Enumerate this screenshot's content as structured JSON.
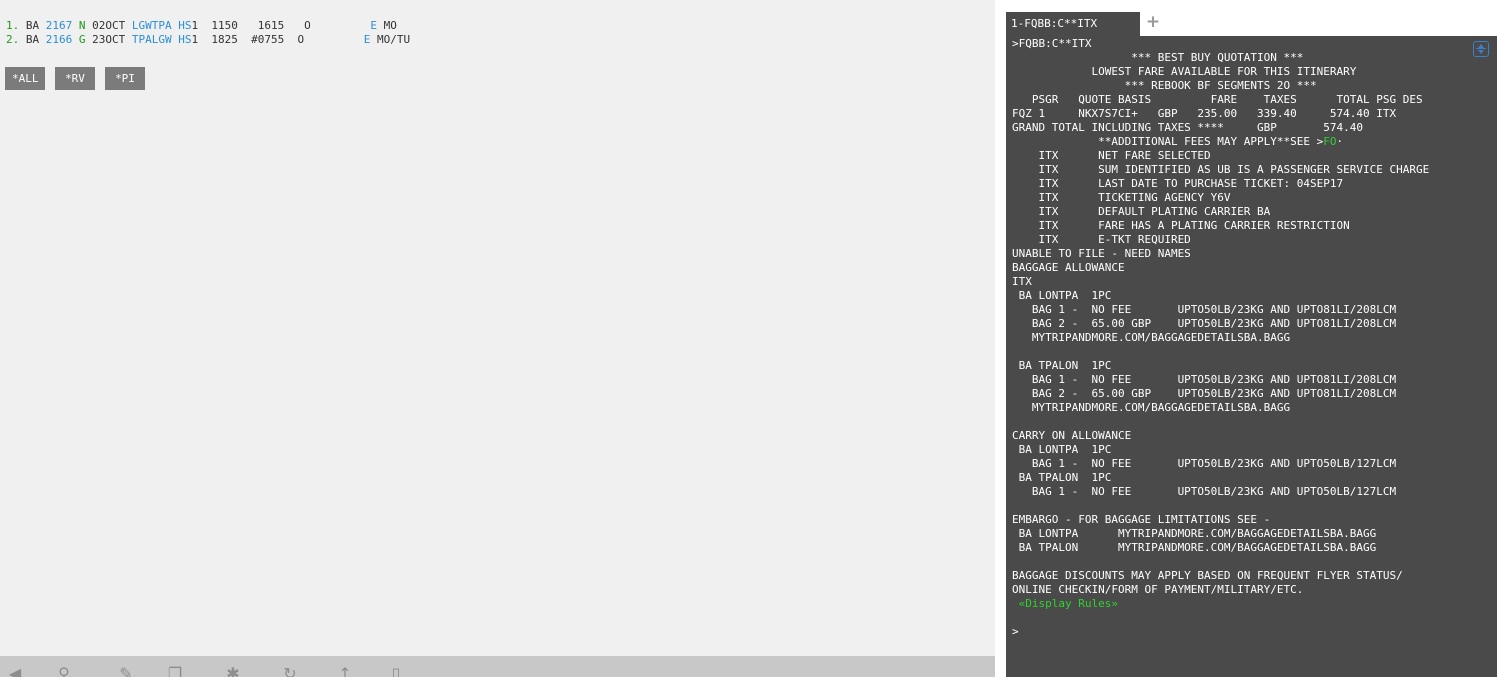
{
  "segments": [
    {
      "num": "1.",
      "carrier": "BA",
      "flight": "2167",
      "class": "N",
      "date": "02OCT",
      "route": "LGWTPA",
      "status": "HS",
      "qty": "1",
      "dep": "1150",
      "arr": "1615",
      "flag": "O",
      "eticket": "E",
      "days": "MO"
    },
    {
      "num": "2.",
      "carrier": "BA",
      "flight": "2166",
      "class": "G",
      "date": "23OCT",
      "route": "TPALGW",
      "status": "HS",
      "qty": "1",
      "dep": "1825",
      "arr": "#0755",
      "flag": "O",
      "eticket": "E",
      "days": "MO/TU"
    }
  ],
  "command_buttons": [
    "*ALL",
    "*RV",
    "*PI"
  ],
  "toolbar_icons": [
    "back-icon",
    "search-icon",
    "edit-icon",
    "copy-icon",
    "settings-icon",
    "refresh-icon",
    "arrow-icon",
    "document-icon"
  ],
  "tabs": [
    {
      "label": "1-FQBB:C**ITX"
    }
  ],
  "tab_add_label": "+",
  "terminal": {
    "lines": [
      ">FQBB:C**ITX",
      "                  *** BEST BUY QUOTATION ***",
      "            LOWEST FARE AVAILABLE FOR THIS ITINERARY",
      "                 *** REBOOK BF SEGMENTS 2O ***",
      "   PSGR   QUOTE BASIS         FARE    TAXES      TOTAL PSG DES",
      "FQZ 1     NKX7S7CI+   GBP   235.00   339.40     574.40 ITX",
      "GRAND TOTAL INCLUDING TAXES ****     GBP       574.40",
      "             **ADDITIONAL FEES MAY APPLY**SEE >",
      "    ITX      NET FARE SELECTED",
      "    ITX      SUM IDENTIFIED AS UB IS A PASSENGER SERVICE CHARGE",
      "    ITX      LAST DATE TO PURCHASE TICKET: 04SEP17",
      "    ITX      TICKETING AGENCY Y6V",
      "    ITX      DEFAULT PLATING CARRIER BA",
      "    ITX      FARE HAS A PLATING CARRIER RESTRICTION",
      "    ITX      E-TKT REQUIRED",
      "UNABLE TO FILE - NEED NAMES",
      "BAGGAGE ALLOWANCE",
      "ITX",
      " BA LONTPA  1PC",
      "   BAG 1 -  NO FEE       UPTO50LB/23KG AND UPTO81LI/208LCM",
      "   BAG 2 -  65.00 GBP    UPTO50LB/23KG AND UPTO81LI/208LCM",
      "   MYTRIPANDMORE.COM/BAGGAGEDETAILSBA.BAGG",
      "",
      " BA TPALON  1PC",
      "   BAG 1 -  NO FEE       UPTO50LB/23KG AND UPTO81LI/208LCM",
      "   BAG 2 -  65.00 GBP    UPTO50LB/23KG AND UPTO81LI/208LCM",
      "   MYTRIPANDMORE.COM/BAGGAGEDETAILSBA.BAGG",
      "",
      "CARRY ON ALLOWANCE",
      " BA LONTPA  1PC",
      "   BAG 1 -  NO FEE       UPTO50LB/23KG AND UPTO50LB/127LCM",
      " BA TPALON  1PC",
      "   BAG 1 -  NO FEE       UPTO50LB/23KG AND UPTO50LB/127LCM",
      "",
      "EMBARGO - FOR BAGGAGE LIMITATIONS SEE -",
      " BA LONTPA      MYTRIPANDMORE.COM/BAGGAGEDETAILSBA.BAGG",
      " BA TPALON      MYTRIPANDMORE.COM/BAGGAGEDETAILSBA.BAGG",
      "",
      "BAGGAGE DISCOUNTS MAY APPLY BASED ON FREQUENT FLYER STATUS/",
      "ONLINE CHECKIN/FORM OF PAYMENT/MILITARY/ETC."
    ],
    "fo_link_text": "FO",
    "fo_suffix": "·",
    "display_rules_link": " «Display Rules»",
    "prompt": ">"
  },
  "colors": {
    "terminal_bg": "#4a4a4a",
    "link_green": "#2fd22f",
    "segment_blue": "#2a8fd8",
    "segment_green": "#1a9a1a",
    "button_bg": "#7b7b7b"
  }
}
